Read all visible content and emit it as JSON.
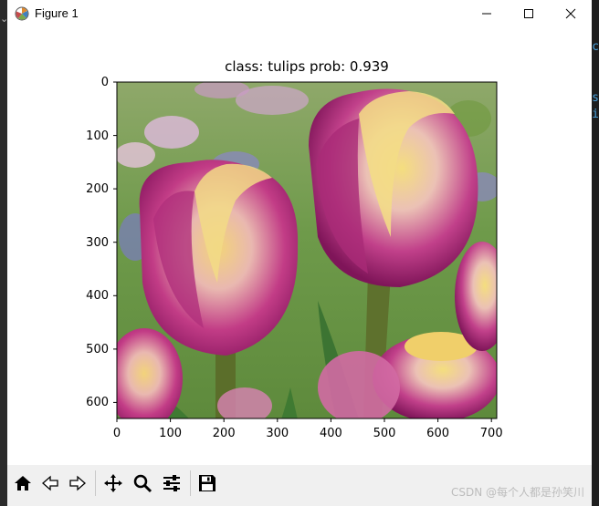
{
  "window": {
    "title": "Figure 1"
  },
  "plot": {
    "title": "class: tulips   prob: 0.939",
    "x_ticks": [
      "0",
      "100",
      "200",
      "300",
      "400",
      "500",
      "600",
      "700"
    ],
    "y_ticks": [
      "0",
      "100",
      "200",
      "300",
      "400",
      "500",
      "600"
    ],
    "x_range": [
      0,
      710
    ],
    "y_range": [
      0,
      630
    ],
    "image_description": "photo of two pink and yellow tulips"
  },
  "toolbar": {
    "buttons": [
      "home-icon",
      "back-arrow-icon",
      "forward-arrow-icon",
      "pan-icon",
      "zoom-icon",
      "configure-subplots-icon",
      "save-icon"
    ]
  },
  "watermark": "CSDN @每个人都是孙笑川",
  "background_editor": {
    "right_edge_chars": [
      "c",
      "s",
      "i"
    ]
  },
  "colors": {
    "axis": "#000000",
    "toolbar_bg": "#f0f0f0",
    "window_bg": "#ffffff"
  }
}
